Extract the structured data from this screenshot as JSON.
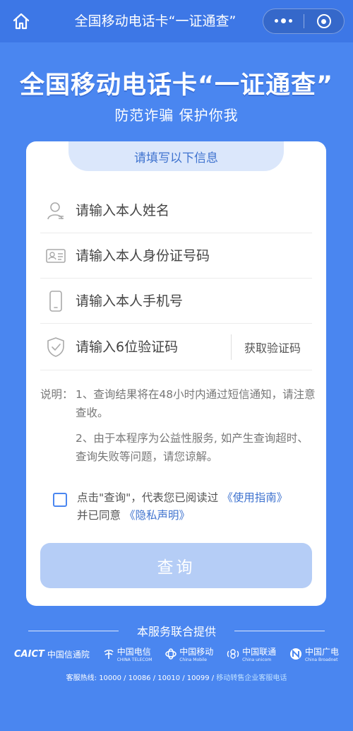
{
  "topbar": {
    "title": "全国移动电话卡“一证通查”",
    "home_icon": "home-icon",
    "more_icon": "more-dots-icon",
    "close_icon": "target-circle-icon"
  },
  "hero": {
    "title": "全国移动电话卡“一证通查”",
    "subtitle": "防范诈骗 保护你我"
  },
  "form": {
    "header": "请填写以下信息",
    "name_placeholder": "请输入本人姓名",
    "id_placeholder": "请输入本人身份证号码",
    "phone_placeholder": "请输入本人手机号",
    "code_placeholder": "请输入6位验证码",
    "get_code_label": "获取验证码"
  },
  "notes": {
    "label": "说明：",
    "item1": "1、查询结果将在48小时内通过短信通知，请注意查收。",
    "item2": "2、由于本程序为公益性服务, 如产生查询超时、查询失败等问题，请您谅解。"
  },
  "agreement": {
    "text_before": "点击\"查询\"，代表您已阅读过",
    "guide_link": "《使用指南》",
    "text_middle": "并已同意",
    "privacy_link": "《隐私声明》"
  },
  "query_button": "查询",
  "footer": {
    "provided_by": "本服务联合提供",
    "logos": [
      {
        "mark": "CAICT",
        "cn": "中国信通院",
        "en": ""
      },
      {
        "mark": "",
        "cn": "中国电信",
        "en": "CHINA TELECOM"
      },
      {
        "mark": "",
        "cn": "中国移动",
        "en": "China Mobile"
      },
      {
        "mark": "",
        "cn": "中国联通",
        "en": "China unicom"
      },
      {
        "mark": "",
        "cn": "中国广电",
        "en": "China Broadnet"
      }
    ],
    "hotline_prefix": "客服热线: 10000 / 10086 / 10010 / 10099 / ",
    "hotline_link": "移动转售企业客服电话"
  },
  "colors": {
    "background": "#4a86f0",
    "topbar": "#3d77e6",
    "accent": "#3f73cf",
    "button_disabled": "#b5cdf6"
  }
}
